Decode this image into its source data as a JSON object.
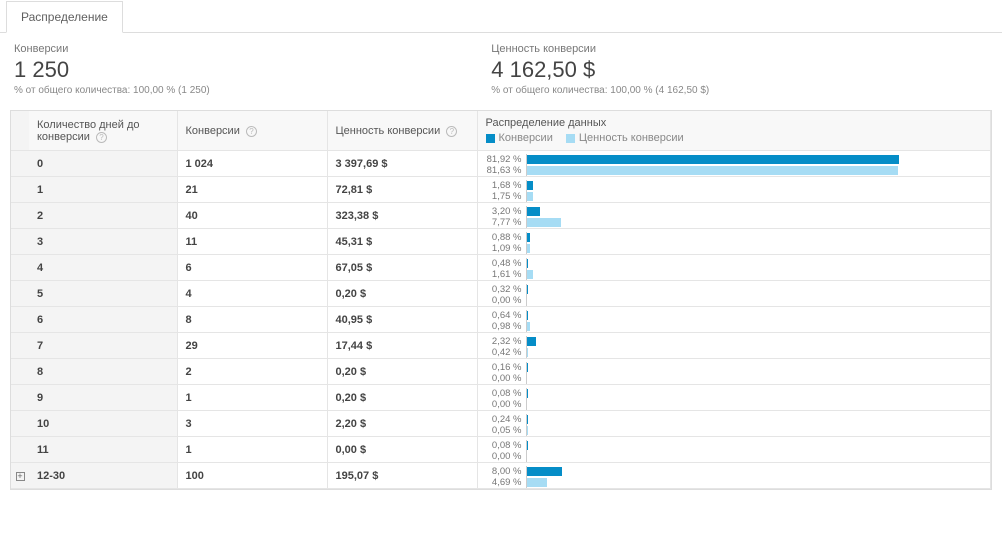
{
  "tab": {
    "label": "Распределение"
  },
  "summary": {
    "conversions": {
      "label": "Конверсии",
      "value": "1 250",
      "sub": "% от общего количества: 100,00 % (1 250)"
    },
    "value": {
      "label": "Ценность конверсии",
      "value": "4 162,50 $",
      "sub": "% от общего количества: 100,00 % (4 162,50 $)"
    }
  },
  "headers": {
    "days": "Количество дней до конверсии",
    "conversions": "Конверсии",
    "value": "Ценность конверсии",
    "distribution": "Распределение данных",
    "legend_conv": "Конверсии",
    "legend_val": "Ценность конверсии"
  },
  "colors": {
    "conv": "#058dc7",
    "val": "#a6dcf4"
  },
  "chart_data": {
    "type": "bar",
    "categories": [
      "0",
      "1",
      "2",
      "3",
      "4",
      "5",
      "6",
      "7",
      "8",
      "9",
      "10",
      "11",
      "12-30"
    ],
    "series": [
      {
        "name": "Конверсии (%)",
        "values": [
          81.92,
          1.68,
          3.2,
          0.88,
          0.48,
          0.32,
          0.64,
          2.32,
          0.16,
          0.08,
          0.24,
          0.08,
          8.0
        ]
      },
      {
        "name": "Ценность конверсии (%)",
        "values": [
          81.63,
          1.75,
          7.77,
          1.09,
          1.61,
          0.0,
          0.98,
          0.42,
          0.0,
          0.0,
          0.05,
          0.0,
          4.69
        ]
      }
    ],
    "xlabel": "Количество дней до конверсии",
    "ylabel": "%",
    "ylim": [
      0,
      100
    ]
  },
  "rows": [
    {
      "days": "0",
      "conv": "1 024",
      "value": "3 397,69 $",
      "pct_conv": "81,92 %",
      "pct_val": "81,63 %",
      "w_conv": 81.92,
      "w_val": 81.63,
      "expandable": false
    },
    {
      "days": "1",
      "conv": "21",
      "value": "72,81 $",
      "pct_conv": "1,68 %",
      "pct_val": "1,75 %",
      "w_conv": 1.68,
      "w_val": 1.75,
      "expandable": false
    },
    {
      "days": "2",
      "conv": "40",
      "value": "323,38 $",
      "pct_conv": "3,20 %",
      "pct_val": "7,77 %",
      "w_conv": 3.2,
      "w_val": 7.77,
      "expandable": false
    },
    {
      "days": "3",
      "conv": "11",
      "value": "45,31 $",
      "pct_conv": "0,88 %",
      "pct_val": "1,09 %",
      "w_conv": 0.88,
      "w_val": 1.09,
      "expandable": false
    },
    {
      "days": "4",
      "conv": "6",
      "value": "67,05 $",
      "pct_conv": "0,48 %",
      "pct_val": "1,61 %",
      "w_conv": 0.48,
      "w_val": 1.61,
      "expandable": false
    },
    {
      "days": "5",
      "conv": "4",
      "value": "0,20 $",
      "pct_conv": "0,32 %",
      "pct_val": "0,00 %",
      "w_conv": 0.32,
      "w_val": 0.0,
      "expandable": false
    },
    {
      "days": "6",
      "conv": "8",
      "value": "40,95 $",
      "pct_conv": "0,64 %",
      "pct_val": "0,98 %",
      "w_conv": 0.64,
      "w_val": 0.98,
      "expandable": false
    },
    {
      "days": "7",
      "conv": "29",
      "value": "17,44 $",
      "pct_conv": "2,32 %",
      "pct_val": "0,42 %",
      "w_conv": 2.32,
      "w_val": 0.42,
      "expandable": false
    },
    {
      "days": "8",
      "conv": "2",
      "value": "0,20 $",
      "pct_conv": "0,16 %",
      "pct_val": "0,00 %",
      "w_conv": 0.16,
      "w_val": 0.0,
      "expandable": false
    },
    {
      "days": "9",
      "conv": "1",
      "value": "0,20 $",
      "pct_conv": "0,08 %",
      "pct_val": "0,00 %",
      "w_conv": 0.08,
      "w_val": 0.0,
      "expandable": false
    },
    {
      "days": "10",
      "conv": "3",
      "value": "2,20 $",
      "pct_conv": "0,24 %",
      "pct_val": "0,05 %",
      "w_conv": 0.24,
      "w_val": 0.05,
      "expandable": false
    },
    {
      "days": "11",
      "conv": "1",
      "value": "0,00 $",
      "pct_conv": "0,08 %",
      "pct_val": "0,00 %",
      "w_conv": 0.08,
      "w_val": 0.0,
      "expandable": false
    },
    {
      "days": "12-30",
      "conv": "100",
      "value": "195,07 $",
      "pct_conv": "8,00 %",
      "pct_val": "4,69 %",
      "w_conv": 8.0,
      "w_val": 4.69,
      "expandable": true
    }
  ]
}
